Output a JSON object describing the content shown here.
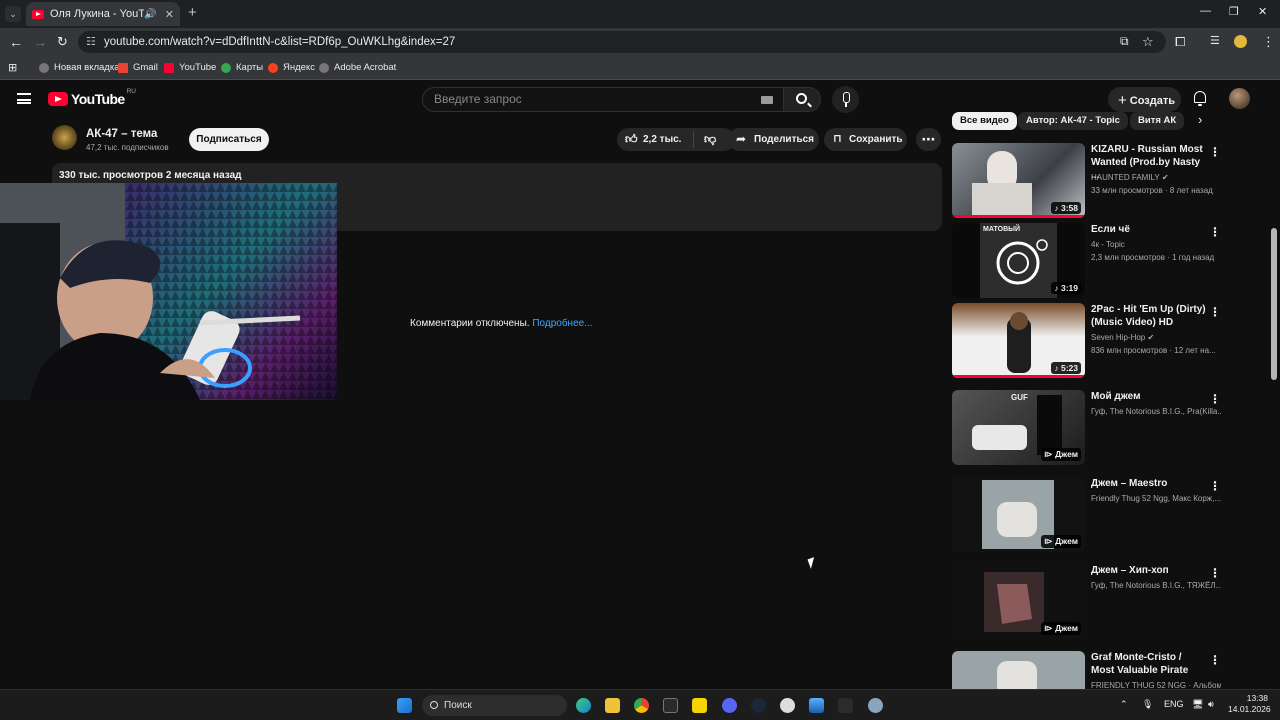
{
  "browser": {
    "tab_title": "Оля Лукина - YouTube",
    "url": "youtube.com/watch?v=dDdfInttN-c&list=RDf6p_OuWKLhg&index=27",
    "new_tab": "+",
    "bookmarks": [
      "Новая вкладка",
      "Gmail",
      "YouTube",
      "Карты",
      "Яндекс",
      "Adobe Acrobat"
    ]
  },
  "header": {
    "logo": "YouTube",
    "country": "RU",
    "search_placeholder": "Введите запрос",
    "create_label": "Создать"
  },
  "channel": {
    "name": "АК-47 – тема",
    "subscribers": "47,2 тыс. подписчиков",
    "subscribe_label": "Подписаться"
  },
  "actions": {
    "likes": "2,2 тыс.",
    "share": "Поделиться",
    "save": "Сохранить",
    "more": "⋯"
  },
  "description": {
    "meta": "330 тыс. просмотров  2 месяца назад"
  },
  "comments": {
    "text": "Комментарии отключены.",
    "link": "Подробнее..."
  },
  "chips": [
    "Все видео",
    "Автор: АК-47 - Topic",
    "Витя АК"
  ],
  "recommendations": [
    {
      "title": "KIZARU - Russian Most Wanted (Prod.by Nasty ...",
      "channel": "HAUNTED FAMILY",
      "verified": true,
      "meta": "33 млн просмотров · 8 лет назад",
      "duration": "3:58",
      "music": true,
      "thumb_text": ""
    },
    {
      "title": "Если чё",
      "channel": "4к - Topic",
      "verified": false,
      "meta": "2,3 млн просмотров · 1 год назад",
      "duration": "3:19",
      "music": true,
      "thumb_text": "МАТОВЫЙ"
    },
    {
      "title": "2Pac - Hit 'Em Up (Dirty) (Music Video) HD",
      "channel": "Seven Hip-Hop",
      "verified": true,
      "meta": "836 млн просмотров · 12 лет на...",
      "duration": "5:23",
      "music": true,
      "thumb_text": ""
    },
    {
      "title": "Мой джем",
      "channel": "Гуф, The Notorious B.I.G., Pra(Killa...",
      "verified": false,
      "meta": "",
      "duration": "Джем",
      "music": false,
      "thumb_text": "GUF"
    },
    {
      "title": "Джем – Maestro",
      "channel": "Friendly Thug 52 Ngg, Макс Корж,...",
      "verified": false,
      "meta": "",
      "duration": "Джем",
      "music": false,
      "thumb_text": ""
    },
    {
      "title": "Джем – Хип-хоп",
      "channel": "Гуф, The Notorious B.I.G., ТЯЖЁЛ...",
      "verified": false,
      "meta": "",
      "duration": "Джем",
      "music": false,
      "thumb_text": ""
    },
    {
      "title": "Graf Monte-Cristo / Most Valuable Pirate",
      "channel": "FRIENDLY THUG 52 NGG · Альбом",
      "verified": false,
      "meta": "",
      "duration": "",
      "music": false,
      "thumb_text": ""
    }
  ],
  "taskbar": {
    "search_label": "Поиск",
    "lang": "ENG",
    "time": "13:38",
    "date": "14.01.2026"
  }
}
